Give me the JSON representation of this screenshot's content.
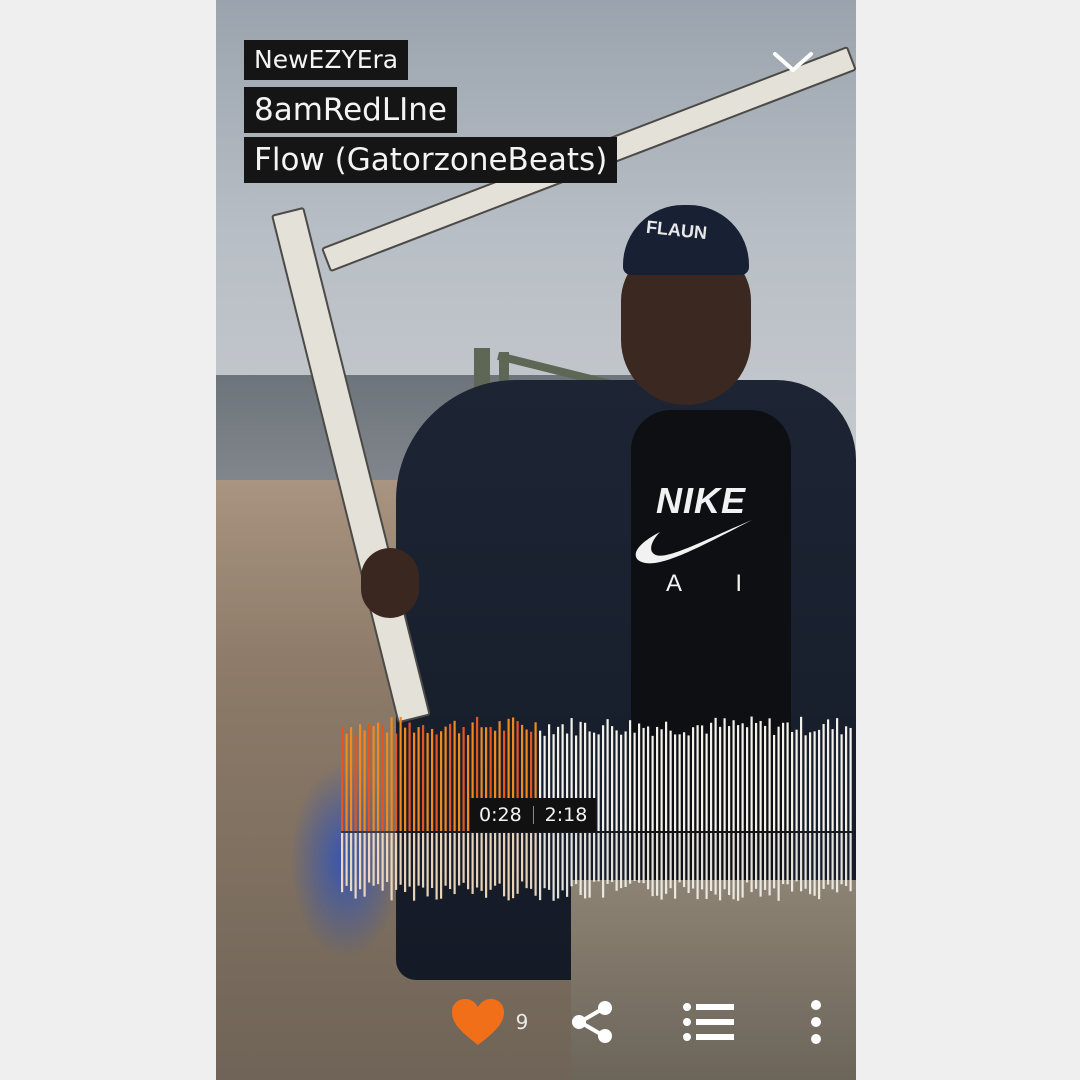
{
  "player": {
    "artist": "NewEZYEra",
    "title_line1": "8amRedLIne",
    "title_line2": "Flow (GatorzoneBeats)",
    "current_time": "0:28",
    "duration": "2:18",
    "progress": 0.38,
    "likes_count": "9"
  },
  "icons": {
    "collapse": "chevron-down-icon",
    "like": "heart-icon",
    "share": "share-icon",
    "queue": "playlist-icon",
    "more": "more-vertical-icon"
  },
  "colors": {
    "played_top": "#f08a1c",
    "played_bottom_accent": "#e8541e",
    "unplayed": "#f3f1ea",
    "heart": "#f26f1a",
    "label_bg": "#151515"
  },
  "artwork": {
    "cap_text": "FLAUN",
    "shirt_brand": "NIKE",
    "shirt_sub": "A I"
  }
}
